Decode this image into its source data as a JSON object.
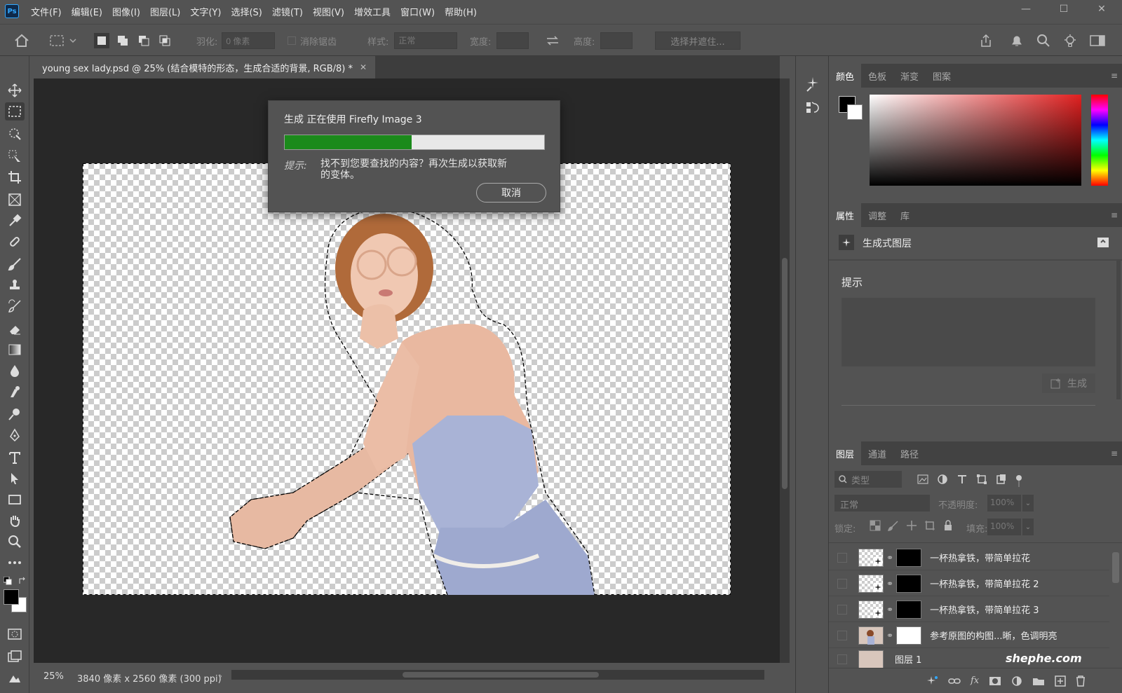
{
  "menu": {
    "items": [
      "文件(F)",
      "编辑(E)",
      "图像(I)",
      "图层(L)",
      "文字(Y)",
      "选择(S)",
      "滤镜(T)",
      "视图(V)",
      "增效工具",
      "窗口(W)",
      "帮助(H)"
    ]
  },
  "options": {
    "feather_label": "羽化:",
    "feather_value": "0 像素",
    "antialias_label": "消除锯齿",
    "style_label": "样式:",
    "style_value": "正常",
    "width_label": "宽度:",
    "height_label": "高度:",
    "select_mask_label": "选择并遮住..."
  },
  "document": {
    "tab_title": "young sex lady.psd @ 25% (结合模特的形态，生成合适的背景, RGB/8) *",
    "zoom": "25%",
    "dimensions": "3840 像素 x 2560 像素 (300 ppi)"
  },
  "dialog": {
    "title": "生成 正在使用 Firefly Image 3",
    "progress": 0.49,
    "tip_label": "提示:",
    "tip_line1": "找不到您要查找的内容？再次生成以获取新",
    "tip_line2": "的变体。",
    "cancel_label": "取消"
  },
  "color_panel": {
    "tabs": [
      "颜色",
      "色板",
      "渐变",
      "图案"
    ],
    "hue_color": "#e12020"
  },
  "properties_panel": {
    "tabs": [
      "属性",
      "调整",
      "库"
    ],
    "layer_type": "生成式图层",
    "prompt_label": "提示",
    "generate_label": "生成"
  },
  "layers_panel": {
    "tabs": [
      "图层",
      "通道",
      "路径"
    ],
    "filter_placeholder": "类型",
    "blend_mode": "正常",
    "opacity_label": "不透明度:",
    "opacity_value": "100%",
    "lock_label": "锁定:",
    "fill_label": "填充:",
    "fill_value": "100%",
    "layers": [
      {
        "name": "一杯热拿铁，带简单拉花"
      },
      {
        "name": "一杯热拿铁，带简单拉花 2"
      },
      {
        "name": "一杯热拿铁，带简单拉花 3"
      },
      {
        "name": "参考原图的构图...晰，色调明亮"
      },
      {
        "name": "图层 1"
      }
    ]
  },
  "watermark": "shephe.com"
}
